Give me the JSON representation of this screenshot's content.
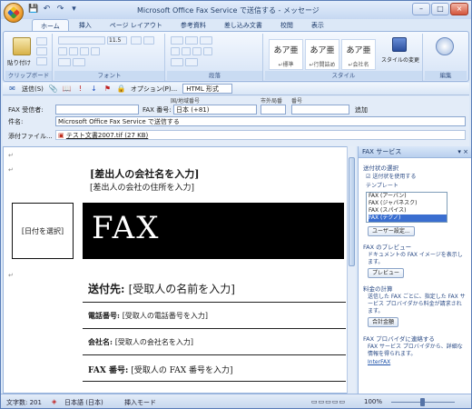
{
  "window": {
    "title": "Microsoft Office Fax Service で送信する - メッセージ",
    "controls": [
      "–",
      "□",
      "×"
    ]
  },
  "quick_access": [
    "💾",
    "↶",
    "↷",
    "▾"
  ],
  "ribbon": {
    "tabs": [
      "ホーム",
      "挿入",
      "ページ レイアウト",
      "参考資料",
      "差し込み文書",
      "校閲",
      "表示"
    ],
    "active_tab": "ホーム",
    "groups": {
      "clipboard": {
        "label": "クリップボード",
        "paste": "貼り付け"
      },
      "font": {
        "label": "フォント",
        "size": "11.5"
      },
      "paragraph": {
        "label": "段落"
      },
      "styles": {
        "label": "スタイル",
        "items": [
          {
            "preview": "あア亜",
            "name": "↵標準"
          },
          {
            "preview": "あア亜",
            "name": "↵行間詰め"
          },
          {
            "preview": "あア亜",
            "name": "↵会社名"
          }
        ],
        "change_styles": "スタイルの変更"
      },
      "edit": {
        "label": "編集"
      }
    }
  },
  "send_bar": {
    "send_label": "送信(S)",
    "options_label": "オプション(P)...",
    "format_value": "HTML 形式"
  },
  "fax_header": {
    "col_country": "国/地域番号",
    "col_area": "市外局番",
    "col_number": "番号",
    "recipient_label": "FAX 受信者:",
    "fax_number_label": "FAX 番号:",
    "country_value": "日本 (+81)",
    "add_label": "追加",
    "subject_label": "件名:",
    "subject_value": "Microsoft Office Fax Service で送信する",
    "attachment_label": "添付ファイル...",
    "attachment_value": "テスト文書2007.tif (27 KB)"
  },
  "document": {
    "sender_name": "[差出人の会社名を入力]",
    "sender_address": "[差出人の会社の住所を入力]",
    "date_placeholder": "[日付を選択]",
    "fax_title": "FAX",
    "to_label": "送付先: ",
    "to_value": "[受取人の名前を入力]",
    "phone_label": "電話番号: ",
    "phone_value": "[受取人の電話番号を入力]",
    "company_label": "会社名: ",
    "company_value": "[受取人の会社名を入力]",
    "fax_label": "FAX 番号: ",
    "fax_value": "[受取人の FAX 番号を入力]"
  },
  "task_pane": {
    "title": "FAX サービス",
    "section_format": "送付状の選択",
    "use_cover": "送付状を使用する",
    "template_label": "テンプレート",
    "templates": [
      "FAX (アーバン)",
      "FAX (ジャパネスク)",
      "FAX (スパイス)",
      "FAX (テクノ)"
    ],
    "selected_template": "FAX (テクノ)",
    "user_settings": "ユーザー設定...",
    "section_preview": "FAX のプレビュー",
    "preview_desc": "ドキュメントの FAX イメージを表示します。",
    "preview_btn": "プレビュー",
    "section_fee": "料金の計算",
    "fee_desc": "送信した FAX ごとに、指定した FAX サービス プロバイダから料金が請求されます。",
    "fee_btn": "合計金額",
    "section_provider": "FAX プロバイダに連絡する",
    "provider_desc": "FAX サービス プロバイダから、詳細な情報を得られます。",
    "provider_link": "InterFAX"
  },
  "status_bar": {
    "word_count": "文字数: 201",
    "language": "日本語 (日本)",
    "mode": "挿入モード",
    "zoom": "100%"
  }
}
